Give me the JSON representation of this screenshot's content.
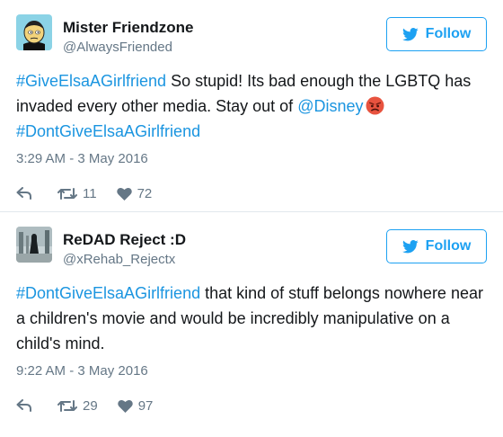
{
  "tweets": [
    {
      "name": "Mister Friendzone",
      "handle": "@AlwaysFriended",
      "follow_label": "Follow",
      "text_parts": {
        "hashtag1": "#GiveElsaAGirlfriend",
        "text1": " So stupid! Its bad enough the LGBTQ has invaded every other media. Stay out of ",
        "mention": "@Disney",
        "hashtag2": "#DontGiveElsaAGirlfriend"
      },
      "emoji": "angry-face-emoji",
      "timestamp": "3:29 AM - 3 May 2016",
      "retweets": "11",
      "likes": "72"
    },
    {
      "name": "ReDAD Reject :D",
      "handle": "@xRehab_Rejectx",
      "follow_label": "Follow",
      "text_parts": {
        "hashtag1": "#DontGiveElsaAGirlfriend",
        "text1": " that kind of stuff belongs nowhere near a children's movie and would be incredibly manipulative on a child's mind."
      },
      "timestamp": "9:22 AM - 3 May 2016",
      "retweets": "29",
      "likes": "97"
    }
  ],
  "colors": {
    "link": "#1b95e0",
    "follow": "#1da1f2",
    "muted": "#657786",
    "text": "#14171a"
  },
  "icons": {
    "follow": "twitter-bird-icon",
    "reply": "reply-icon",
    "retweet": "retweet-icon",
    "like": "heart-icon"
  }
}
